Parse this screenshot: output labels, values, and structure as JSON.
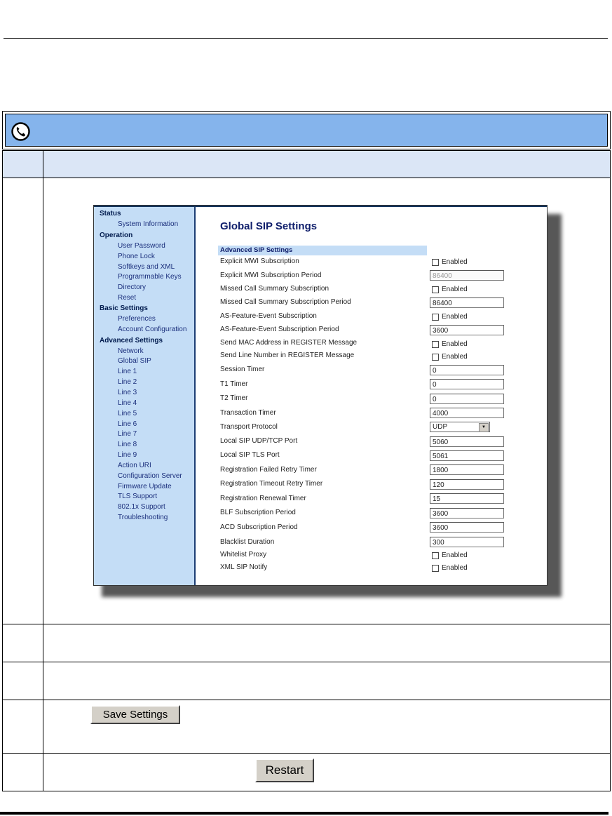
{
  "nav": {
    "sections": [
      {
        "heading": "Status",
        "items": [
          "System Information"
        ]
      },
      {
        "heading": "Operation",
        "items": [
          "User Password",
          "Phone Lock",
          "Softkeys and XML",
          "Programmable Keys",
          "Directory",
          "Reset"
        ]
      },
      {
        "heading": "Basic Settings",
        "items": [
          "Preferences",
          "Account Configuration"
        ]
      },
      {
        "heading": "Advanced Settings",
        "items": [
          "Network",
          "Global SIP",
          "Line 1",
          "Line 2",
          "Line 3",
          "Line 4",
          "Line 5",
          "Line 6",
          "Line 7",
          "Line 8",
          "Line 9",
          "Action URI",
          "Configuration Server",
          "Firmware Update",
          "TLS Support",
          "802.1x Support",
          "Troubleshooting"
        ]
      }
    ]
  },
  "page": {
    "title": "Global SIP Settings",
    "section_title": "Advanced SIP Settings",
    "fields": [
      {
        "label": "Explicit MWI Subscription",
        "type": "checkbox",
        "value": "Enabled",
        "checked": false
      },
      {
        "label": "Explicit MWI Subscription Period",
        "type": "text",
        "value": "86400",
        "disabled": true
      },
      {
        "label": "Missed Call Summary Subscription",
        "type": "checkbox",
        "value": "Enabled",
        "checked": false
      },
      {
        "label": "Missed Call Summary Subscription Period",
        "type": "text",
        "value": "86400"
      },
      {
        "label": "AS-Feature-Event Subscription",
        "type": "checkbox",
        "value": "Enabled",
        "checked": false
      },
      {
        "label": "AS-Feature-Event Subscription Period",
        "type": "text",
        "value": "3600"
      },
      {
        "label": "Send MAC Address in REGISTER Message",
        "type": "checkbox",
        "value": "Enabled",
        "checked": false
      },
      {
        "label": "Send Line Number in REGISTER Message",
        "type": "checkbox",
        "value": "Enabled",
        "checked": false
      },
      {
        "label": "Session Timer",
        "type": "text",
        "value": "0"
      },
      {
        "label": "T1 Timer",
        "type": "text",
        "value": "0"
      },
      {
        "label": "T2 Timer",
        "type": "text",
        "value": "0"
      },
      {
        "label": "Transaction Timer",
        "type": "text",
        "value": "4000"
      },
      {
        "label": "Transport Protocol",
        "type": "select",
        "value": "UDP"
      },
      {
        "label": "Local SIP UDP/TCP Port",
        "type": "text",
        "value": "5060"
      },
      {
        "label": "Local SIP TLS Port",
        "type": "text",
        "value": "5061"
      },
      {
        "label": "Registration Failed Retry Timer",
        "type": "text",
        "value": "1800"
      },
      {
        "label": "Registration Timeout Retry Timer",
        "type": "text",
        "value": "120"
      },
      {
        "label": "Registration Renewal Timer",
        "type": "text",
        "value": "15"
      },
      {
        "label": "BLF Subscription Period",
        "type": "text",
        "value": "3600"
      },
      {
        "label": "ACD Subscription Period",
        "type": "text",
        "value": "3600"
      },
      {
        "label": "Blacklist Duration",
        "type": "text",
        "value": "300"
      },
      {
        "label": "Whitelist Proxy",
        "type": "checkbox",
        "value": "Enabled",
        "checked": false
      },
      {
        "label": "XML SIP Notify",
        "type": "checkbox",
        "value": "Enabled",
        "checked": false
      }
    ]
  },
  "buttons": {
    "save": "Save Settings",
    "restart": "Restart"
  },
  "icons": {
    "header": "phone-handset-icon"
  },
  "colors": {
    "header_band": "#85b4ec",
    "table_header": "#dbe6f6",
    "nav_background": "#c4ddf6",
    "title_text": "#0f1e6b"
  }
}
